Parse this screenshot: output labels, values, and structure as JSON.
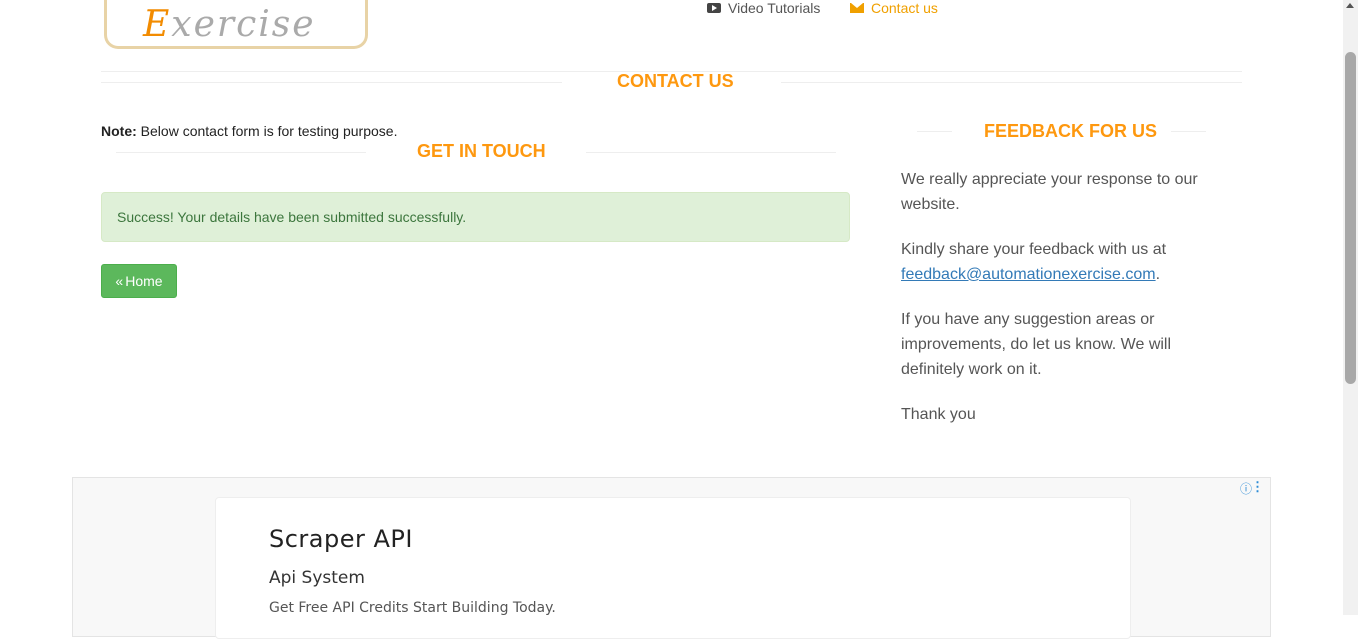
{
  "header": {
    "logo_text_first": "E",
    "logo_text_rest": "xercise",
    "nav": [
      {
        "label": "Video Tutorials",
        "icon": "youtube-icon"
      },
      {
        "label": "Contact us",
        "icon": "envelope-icon",
        "active": true
      }
    ]
  },
  "contact": {
    "title": "Contact Us",
    "note_label": "Note:",
    "note_text": " Below contact form is for testing purpose.",
    "get_in_touch": "Get In Touch",
    "success_message": "Success! Your details have been submitted successfully.",
    "home_button": "Home",
    "home_icon": "double-chevron-left-icon"
  },
  "feedback": {
    "title": "Feedback For Us",
    "p1": "We really appreciate your response to our website.",
    "p2_prefix": "Kindly share your feedback with us at ",
    "email": "feedback@automationexercise.com",
    "p2_suffix": ".",
    "p3": "If you have any suggestion areas or improvements, do let us know. We will definitely work on it.",
    "p4": "Thank you"
  },
  "ad": {
    "title": "Scraper API",
    "subtitle": "Api System",
    "description": "Get Free API Credits Start Building Today.",
    "info_icon": "info-icon",
    "menu_icon": "kebab-menu-icon"
  },
  "colors": {
    "accent": "#fe980f",
    "success_bg": "#dff0d8",
    "success_text": "#3c763d",
    "button_green": "#5cb85c",
    "link": "#337ab7"
  }
}
